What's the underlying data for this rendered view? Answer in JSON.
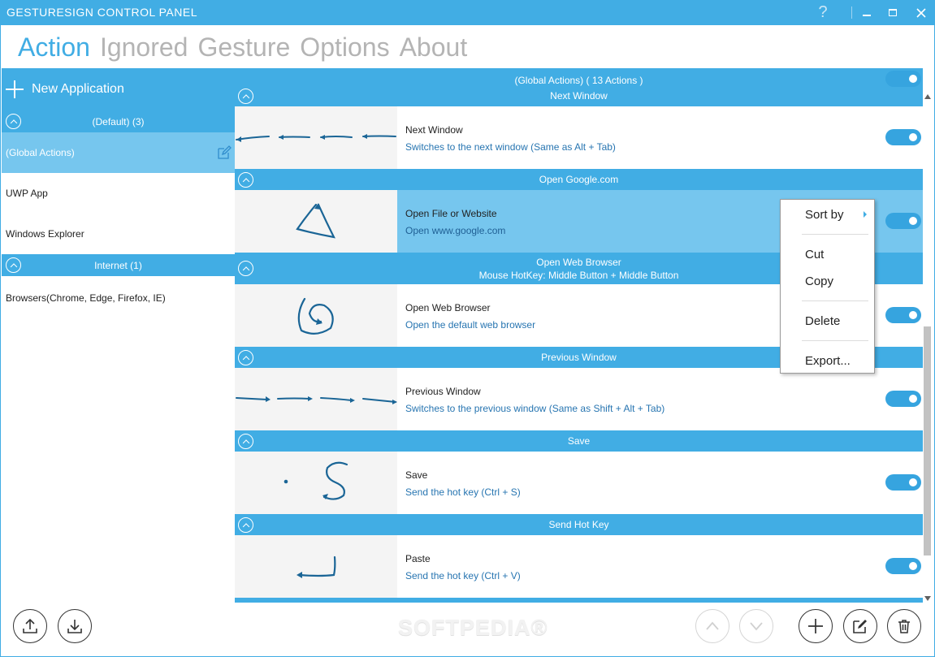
{
  "window": {
    "title": "GESTURESIGN CONTROL PANEL",
    "help_label": "?"
  },
  "tabs": [
    "Action",
    "Ignored",
    "Gesture",
    "Options",
    "About"
  ],
  "sidebar": {
    "new_app_label": "New Application",
    "groups": [
      {
        "title": "(Default) (3)",
        "items": [
          "(Global Actions)",
          "UWP App",
          "Windows Explorer"
        ]
      },
      {
        "title": "Internet (1)",
        "items": [
          "Browsers(Chrome, Edge, Firefox, IE)"
        ]
      }
    ]
  },
  "main": {
    "group_title": "(Global Actions)   ( 13 Actions )",
    "first_section_label": "Next Window",
    "sections": [
      {
        "header": "Open Google.com",
        "name": "Open File or Website",
        "desc": "Open www.google.com"
      },
      {
        "header": "Open Web Browser",
        "header2": "Mouse HotKey: Middle Button + Middle Button",
        "name": "Open Web Browser",
        "desc": "Open the default web browser"
      },
      {
        "header": "Previous Window",
        "name": "Previous Window",
        "desc": "Switches to the previous window (Same as Shift + Alt + Tab)"
      },
      {
        "header": "Save",
        "name": "Save",
        "desc": "Send the hot key (Ctrl + S)"
      },
      {
        "header": "Send Hot Key",
        "name": "Paste",
        "desc": "Send the hot key (Ctrl + V)"
      }
    ],
    "first_row": {
      "name": "Next Window",
      "desc": "Switches to the next window (Same as Alt + Tab)"
    }
  },
  "context_menu": {
    "items": [
      "Sort by",
      "Cut",
      "Copy",
      "Delete",
      "Export..."
    ]
  },
  "watermark": "SOFTPEDIA®",
  "colors": {
    "accent": "#41ade4",
    "highlight": "#76c6ee",
    "gesture_stroke": "#1a6596",
    "desc_text": "#2775b1"
  }
}
